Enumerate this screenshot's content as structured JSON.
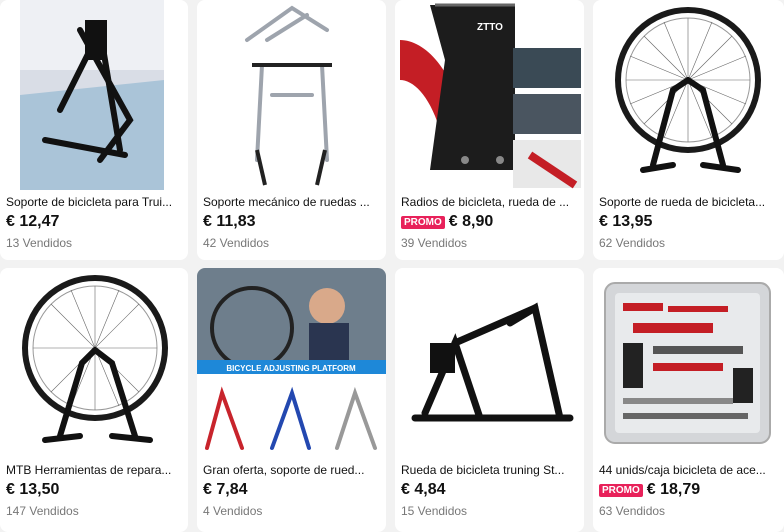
{
  "products": [
    {
      "title": "Soporte de bicicleta para Trui...",
      "price": "€ 12,47",
      "sold": "13 Vendidos",
      "promo": ""
    },
    {
      "title": "Soporte mecánico de ruedas ...",
      "price": "€ 11,83",
      "sold": "42 Vendidos",
      "promo": ""
    },
    {
      "title": "Radios de bicicleta, rueda de ...",
      "price": "€ 8,90",
      "sold": "39 Vendidos",
      "promo": "PROMO"
    },
    {
      "title": "Soporte de rueda de bicicleta...",
      "price": "€ 13,95",
      "sold": "62 Vendidos",
      "promo": ""
    },
    {
      "title": "MTB Herramientas de repara...",
      "price": "€ 13,50",
      "sold": "147 Vendidos",
      "promo": ""
    },
    {
      "title": "Gran oferta, soporte de rued...",
      "price": "€ 7,84",
      "sold": "4 Vendidos",
      "promo": "",
      "banner": "BICYCLE ADJUSTING PLATFORM"
    },
    {
      "title": "Rueda de bicicleta truning St...",
      "price": "€ 4,84",
      "sold": "15 Vendidos",
      "promo": ""
    },
    {
      "title": "44 unids/caja bicicleta de ace...",
      "price": "€ 18,79",
      "sold": "63 Vendidos",
      "promo": "PROMO"
    }
  ],
  "colors": {
    "promo": "#e8215a",
    "sold": "#777777",
    "background": "#f2f2f2"
  },
  "image_brand": "ZTTO"
}
